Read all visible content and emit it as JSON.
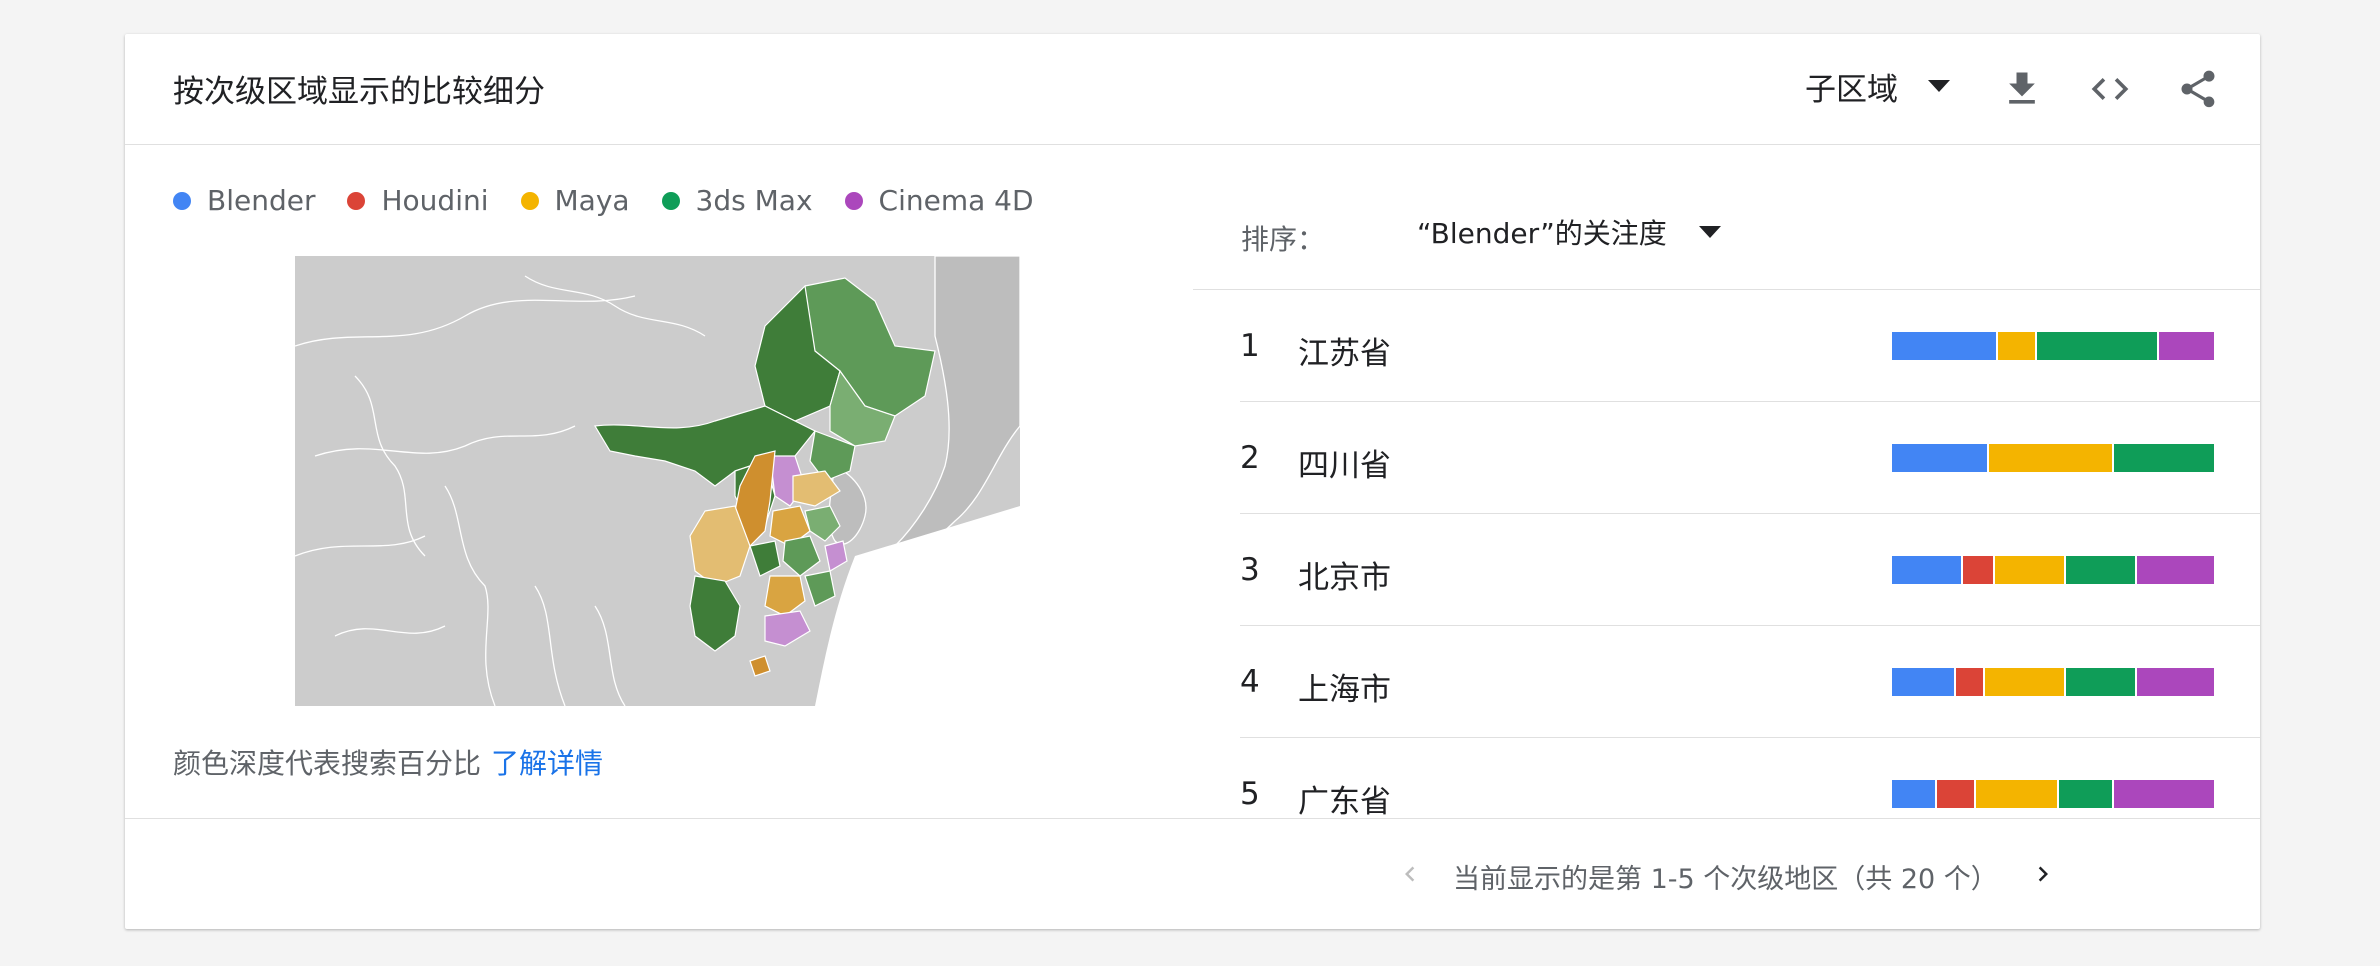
{
  "header": {
    "title": "按次级区域显示的比较细分",
    "region_select": "子区域",
    "icons": [
      "download-icon",
      "embed-code-icon",
      "share-icon"
    ]
  },
  "legend": [
    {
      "label": "Blender",
      "color": "#4285f4"
    },
    {
      "label": "Houdini",
      "color": "#db4437"
    },
    {
      "label": "Maya",
      "color": "#f4b400"
    },
    {
      "label": "3ds Max",
      "color": "#0f9d58"
    },
    {
      "label": "Cinema 4D",
      "color": "#ab47bc"
    }
  ],
  "footnote": {
    "text": "颜色深度代表搜索百分比",
    "link": "了解详情"
  },
  "sort": {
    "label": "排序：",
    "value": "“Blender”的关注度"
  },
  "rankings": [
    {
      "rank": "1",
      "name": "江苏省",
      "shares": [
        0.33,
        0.0,
        0.12,
        0.38,
        0.17
      ]
    },
    {
      "rank": "2",
      "name": "四川省",
      "shares": [
        0.3,
        0.0,
        0.39,
        0.31,
        0.0
      ]
    },
    {
      "rank": "3",
      "name": "北京市",
      "shares": [
        0.22,
        0.1,
        0.22,
        0.22,
        0.24
      ]
    },
    {
      "rank": "4",
      "name": "上海市",
      "shares": [
        0.2,
        0.09,
        0.25,
        0.22,
        0.24
      ]
    },
    {
      "rank": "5",
      "name": "广东省",
      "shares": [
        0.14,
        0.12,
        0.26,
        0.17,
        0.31
      ]
    }
  ],
  "pager": {
    "text": "当前显示的是第 1-5 个次级地区（共 20 个）"
  },
  "map_colors": {
    "land": "#cccccc",
    "border": "#ffffff",
    "green_dark": "#3f7d39",
    "green_mid": "#5e9a58",
    "green_light": "#7aae72",
    "gold_dark": "#cf8f2e",
    "gold_mid": "#d9a441",
    "gold_light": "#e3bd72",
    "purple": "#c58fd1",
    "sea": "#ffffff"
  }
}
